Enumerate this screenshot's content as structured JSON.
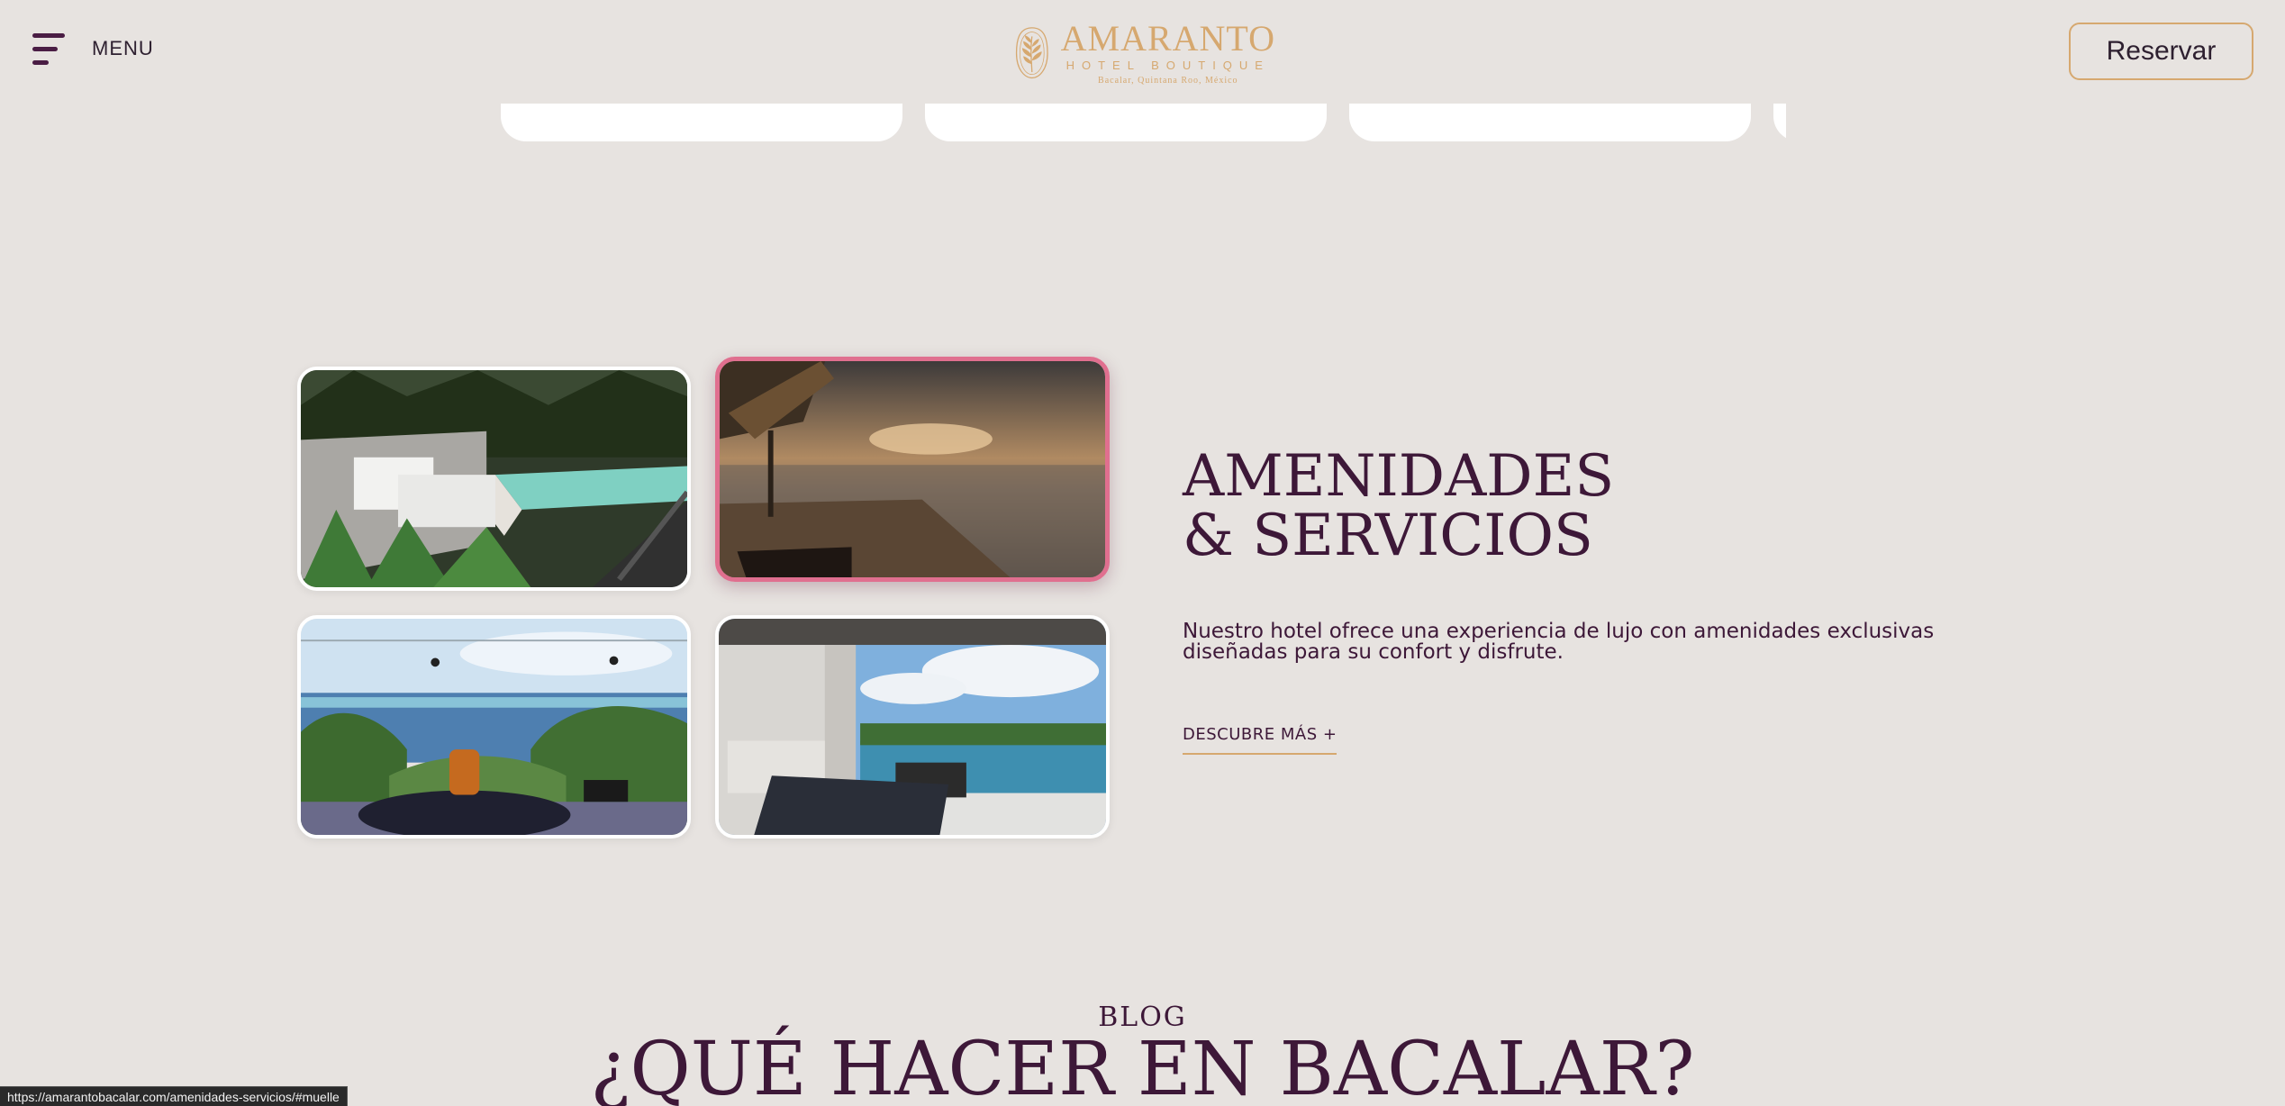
{
  "header": {
    "menu_label": "MENU",
    "logo": {
      "name": "AMARANTO",
      "subtitle": "HOTEL BOUTIQUE",
      "tagline": "Bacalar, Quintana Roo, México"
    },
    "reserve_label": "Reservar"
  },
  "amenities": {
    "title_line1": "AMENIDADES",
    "title_line2": "& SERVICIOS",
    "description": "Nuestro hotel ofrece una experiencia de lujo con amenidades exclusivas diseñadas para su confort y disfrute.",
    "cta_label": "DESCUBRE MÁS +",
    "photos": [
      {
        "id": "pool-terrace",
        "active": false
      },
      {
        "id": "dock-sunset",
        "active": true
      },
      {
        "id": "lagoon-view-drink",
        "active": false
      },
      {
        "id": "suite-terrace",
        "active": false
      }
    ]
  },
  "blog": {
    "kicker": "BLOG",
    "title": "¿QUÉ HACER EN BACALAR?"
  },
  "status_bar": {
    "url": "https://amarantobacalar.com/amenidades-servicios/#muelle"
  },
  "colors": {
    "background": "#e7e3e0",
    "primary": "#3d1838",
    "gold": "#d6a86f",
    "active_border": "#e06f8f"
  }
}
